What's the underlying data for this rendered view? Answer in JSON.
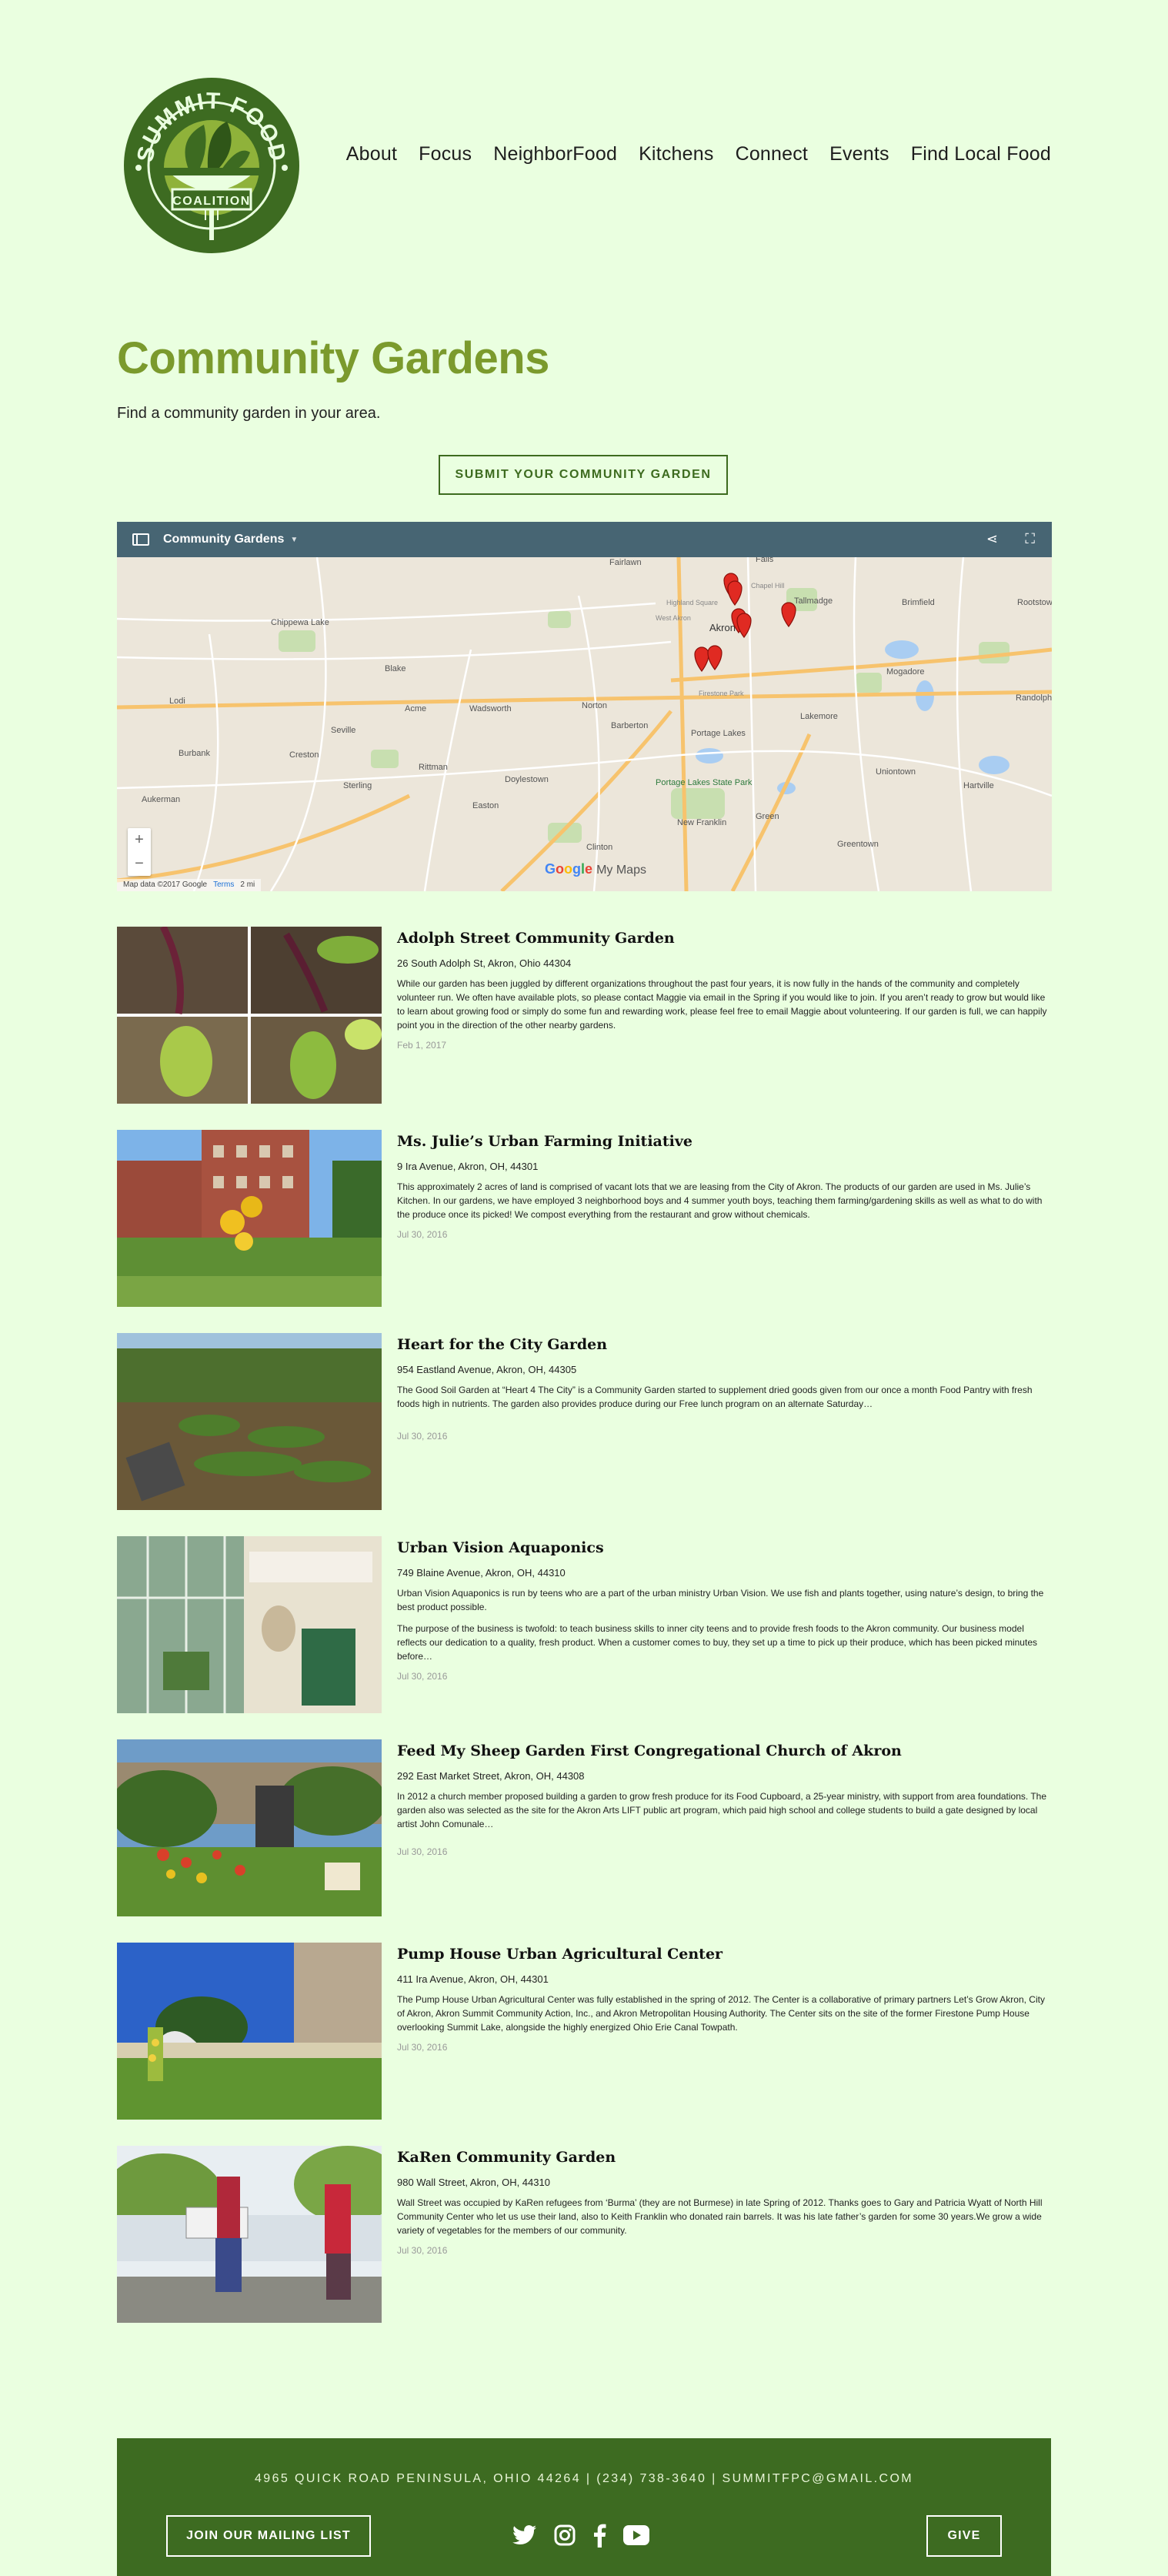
{
  "brand": {
    "logo_text_top": "SUMMIT FOOD",
    "logo_text_bottom": "COALITION",
    "colors": {
      "logo_green": "#3d6b21",
      "leaf_light": "#8fb23a",
      "title_green": "#7b9a2d",
      "background": "#eaffe0"
    }
  },
  "nav": {
    "items": [
      "About",
      "Focus",
      "NeighborFood",
      "Kitchens",
      "Connect",
      "Events",
      "Find Local Food"
    ]
  },
  "page": {
    "title": "Community Gardens",
    "intro": "Find a community garden in your area.",
    "submit_label": "SUBMIT YOUR COMMUNITY GARDEN"
  },
  "map": {
    "title": "Community Gardens",
    "attribution": "Map data ©2017 Google",
    "terms": "Terms",
    "scale": "2 mi",
    "logo_google": "Google",
    "logo_suffix": "My Maps",
    "icons": [
      "sidebar-icon",
      "share-icon",
      "fullscreen-icon",
      "zoom-in-icon",
      "zoom-out-icon",
      "map-marker-icon"
    ],
    "places": [
      "Fairlawn",
      "Falls",
      "Tallmadge",
      "Brimfield",
      "Rootstow",
      "Chippewa Lake",
      "Akron",
      "Blake",
      "Lodi",
      "Acme",
      "Wadsworth",
      "Norton",
      "Barberton",
      "Mogadore",
      "Randolph",
      "Lakemore",
      "Seville",
      "Portage Lakes",
      "Burbank",
      "Creston",
      "Rittman",
      "Doylestown",
      "Portage Lakes State Park",
      "Uniontown",
      "Hartville",
      "Sterling",
      "Aukerman",
      "Easton",
      "New Franklin",
      "Green",
      "Clinton",
      "Greentown",
      "West Akron",
      "Highland Square",
      "Chapel Hill",
      "Firestone Park"
    ]
  },
  "gardens": [
    {
      "name": "Adolph Street Community Garden",
      "address": "26 South Adolph St, Akron, Ohio 44304",
      "desc": "While our garden has been juggled by different organizations throughout the past four years, it is now fully in the hands of the community and completely volunteer run.  We often have available plots, so please contact Maggie via email in the Spring if you would like to join.  If you aren’t ready to grow but would like to learn about growing food or simply do some fun and rewarding work, please feel free to email Maggie about volunteering.  If our garden is full, we can happily point you in the direction of the other nearby gardens.",
      "desc2": "",
      "date": "Feb 1, 2017"
    },
    {
      "name": "Ms. Julie’s Urban Farming Initiative",
      "address": "9 Ira Avenue, Akron, OH, 44301",
      "desc": "This approximately 2 acres of land is comprised of vacant lots that we are leasing from the City of Akron. The products of our garden are used in Ms. Julie’s Kitchen.  In our gardens, we have employed 3 neighborhood boys and 4 summer youth boys,  teaching them farming/gardening skills as well as what to do with the produce once its picked! We compost everything from the restaurant and grow without chemicals.",
      "desc2": "",
      "date": "Jul 30, 2016"
    },
    {
      "name": "Heart for the City Garden",
      "address": "954 Eastland Avenue, Akron, OH, 44305",
      "desc": "The Good Soil Garden at “Heart 4 The City” is a Community Garden started to supplement dried goods given from our once a month Food Pantry with fresh foods high in nutrients. The garden also provides produce during our Free lunch program on an alternate Saturday…",
      "desc2": "",
      "date": "Jul 30, 2016"
    },
    {
      "name": "Urban Vision Aquaponics",
      "address": "749 Blaine Avenue, Akron, OH, 44310",
      "desc": "Urban Vision Aquaponics is run by teens who are a part of the urban ministry Urban Vision. We use fish and plants together, using nature’s design, to bring the best product possible.",
      "desc2": "The purpose of the business is twofold: to teach business skills to inner city teens and to provide fresh foods to the Akron community. Our business model reflects our dedication to a quality, fresh product. When a customer comes to buy, they set up a time to pick up their produce, which has been picked minutes before…",
      "date": "Jul 30, 2016"
    },
    {
      "name": "Feed My Sheep Garden First Congregational Church of Akron",
      "address": "292 East Market Street, Akron, OH, 44308",
      "desc": "In 2012 a church member proposed building a garden to grow fresh produce for its Food Cupboard, a 25-year ministry, with support from area foundations. The garden also was selected as the site for the Akron Arts LIFT public art program, which paid high school and college students to build a gate designed by local artist John Comunale…",
      "desc2": "",
      "date": "Jul 30, 2016"
    },
    {
      "name": "Pump House Urban Agricultural Center",
      "address": "411 Ira Avenue, Akron, OH, 44301",
      "desc": "The Pump House Urban Agricultural Center was fully established in the spring of 2012. The Center is a collaborative of primary partners Let’s Grow Akron, City of Akron, Akron Summit Community Action, Inc., and Akron Metropolitan Housing Authority. The Center sits on the site of the former Firestone Pump House overlooking Summit Lake, alongside the highly energized Ohio Erie Canal Towpath.",
      "desc2": "",
      "date": "Jul 30, 2016"
    },
    {
      "name": "KaRen Community Garden",
      "address": "980 Wall Street, Akron, OH, 44310",
      "desc": "Wall Street was occupied by KaRen refugees from ‘Burma’ (they are not Burmese) in late Spring of 2012. Thanks goes to Gary and Patricia Wyatt of North Hill Community Center who let us use their land, also to Keith Franklin who donated rain barrels. It was his late father’s garden for some 30 years.We grow a wide variety of vegetables for the members of our community.",
      "desc2": "",
      "date": "Jul 30, 2016"
    }
  ],
  "footer": {
    "contact": "4965 QUICK ROAD PENINSULA, OHIO 44264   |   (234) 738-3640 |   SUMMITFPC@GMAIL.COM",
    "mailing_label": "JOIN OUR MAILING LIST",
    "give_label": "GIVE",
    "social_icons": [
      "twitter-icon",
      "instagram-icon",
      "facebook-icon",
      "youtube-icon"
    ]
  }
}
